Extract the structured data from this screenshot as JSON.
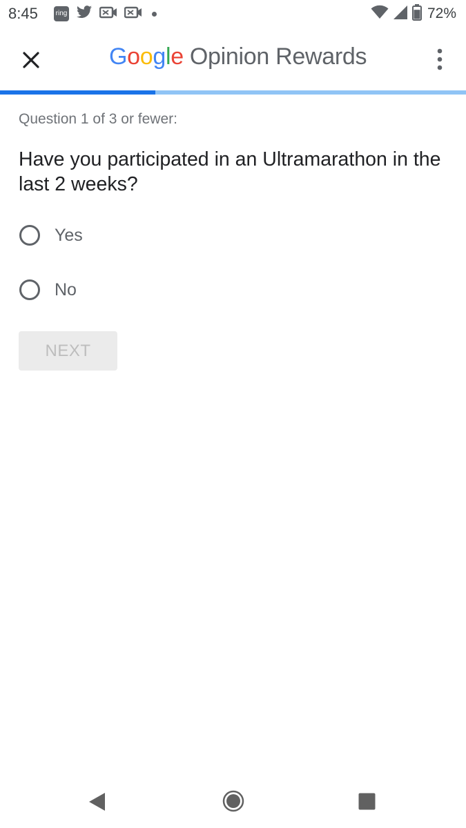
{
  "status_bar": {
    "time": "8:45",
    "ring_label": "ring",
    "battery_percent": "72%",
    "battery_level": 0.72
  },
  "app_bar": {
    "brand_letters": [
      "G",
      "o",
      "o",
      "g",
      "l",
      "e"
    ],
    "brand_rest": "Opinion Rewards",
    "close_icon": "close-icon",
    "menu_icon": "more-vert-icon"
  },
  "progress": {
    "fraction": 0.333
  },
  "survey": {
    "question_number": "Question 1 of 3 or fewer:",
    "question_text": "Have you participated in an Ultramarathon in the last 2 weeks?",
    "options": [
      {
        "label": "Yes",
        "selected": false
      },
      {
        "label": "No",
        "selected": false
      }
    ],
    "next_label": "NEXT",
    "next_enabled": false
  },
  "colors": {
    "google_blue": "#4285F4",
    "google_red": "#EA4335",
    "google_yellow": "#FBBC05",
    "google_green": "#34A853",
    "progress_fill": "#1a73e8",
    "progress_track": "#90c4f5"
  }
}
